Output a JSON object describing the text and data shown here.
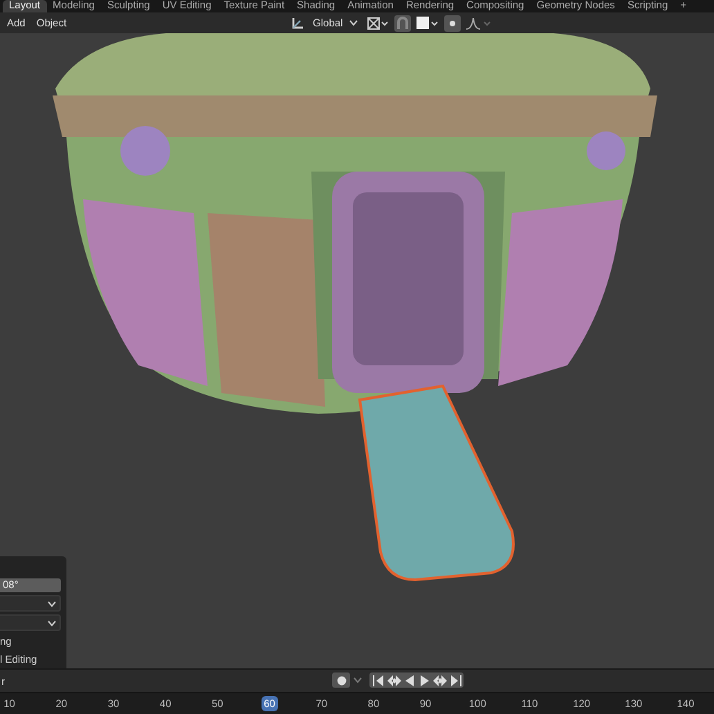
{
  "tabs": [
    {
      "label": "Layout",
      "selected": true
    },
    {
      "label": "Modeling",
      "selected": false
    },
    {
      "label": "Sculpting",
      "selected": false
    },
    {
      "label": "UV Editing",
      "selected": false
    },
    {
      "label": "Texture Paint",
      "selected": false
    },
    {
      "label": "Shading",
      "selected": false
    },
    {
      "label": "Animation",
      "selected": false
    },
    {
      "label": "Rendering",
      "selected": false
    },
    {
      "label": "Compositing",
      "selected": false
    },
    {
      "label": "Geometry Nodes",
      "selected": false
    },
    {
      "label": "Scripting",
      "selected": false
    }
  ],
  "add_tab": "+",
  "header": {
    "menus": [
      "Add",
      "Object"
    ],
    "orientation": "Global"
  },
  "operator_panel": {
    "angle_field": "08°",
    "options": [
      "ng",
      "l Editing"
    ]
  },
  "timeline": {
    "label": "r",
    "frames": [
      {
        "label": "10",
        "selected": false
      },
      {
        "label": "20",
        "selected": false
      },
      {
        "label": "30",
        "selected": false
      },
      {
        "label": "40",
        "selected": false
      },
      {
        "label": "50",
        "selected": false
      },
      {
        "label": "60",
        "selected": true
      },
      {
        "label": "70",
        "selected": false
      },
      {
        "label": "80",
        "selected": false
      },
      {
        "label": "90",
        "selected": false
      },
      {
        "label": "100",
        "selected": false
      },
      {
        "label": "110",
        "selected": false
      },
      {
        "label": "120",
        "selected": false
      },
      {
        "label": "130",
        "selected": false
      },
      {
        "label": "140",
        "selected": false
      }
    ]
  }
}
